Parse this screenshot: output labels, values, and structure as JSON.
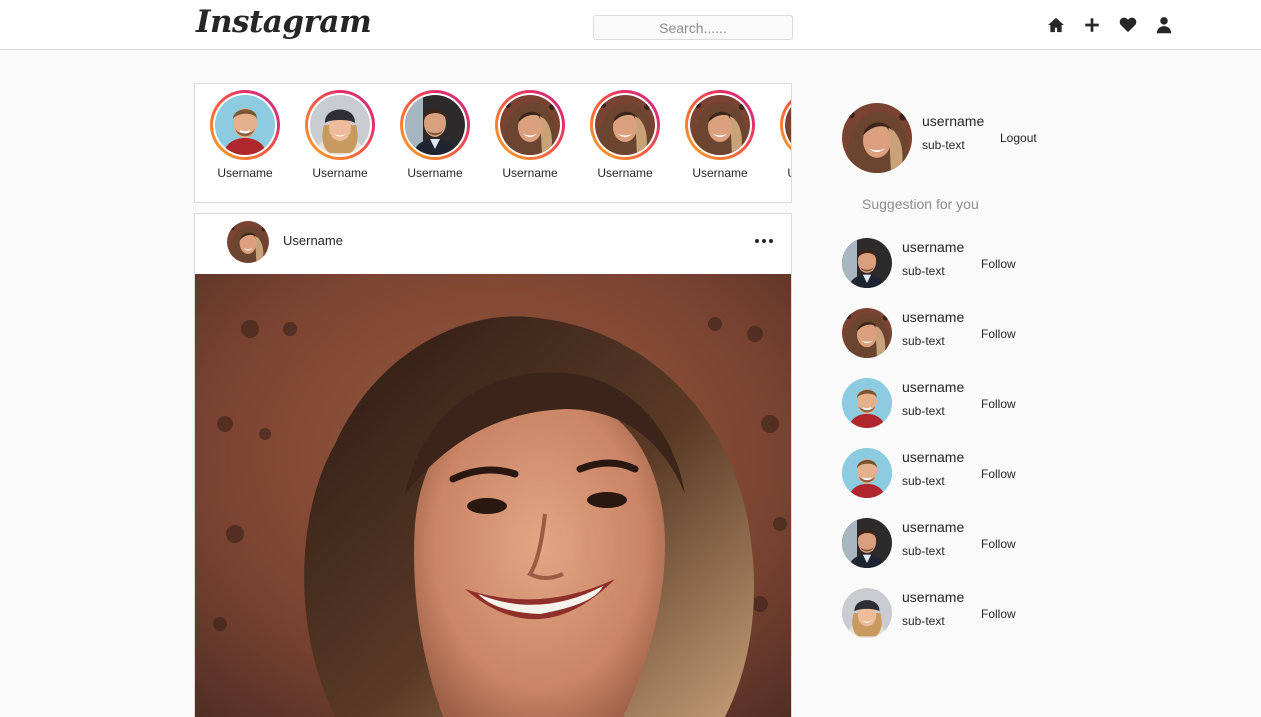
{
  "navbar": {
    "logo": "Instagram",
    "search_placeholder": "Search......",
    "icons": [
      "home-icon",
      "plus-icon",
      "heart-icon",
      "user-icon"
    ]
  },
  "stories": [
    {
      "username": "Username",
      "avatar": "man-light"
    },
    {
      "username": "Username",
      "avatar": "woman-beanie"
    },
    {
      "username": "Username",
      "avatar": "man-dark"
    },
    {
      "username": "Username",
      "avatar": "woman-curly"
    },
    {
      "username": "Username",
      "avatar": "woman-curly"
    },
    {
      "username": "Username",
      "avatar": "woman-curly"
    },
    {
      "username": "Username",
      "avatar": "woman-curly"
    }
  ],
  "post": {
    "username": "Username",
    "avatar": "woman-curly",
    "more_icon": "more-dots-icon"
  },
  "profile": {
    "username": "username",
    "sub_text": "sub-text",
    "logout_label": "Logout"
  },
  "suggestions_title": "Suggestion for you",
  "suggestions": [
    {
      "username": "username",
      "sub_text": "sub-text",
      "action": "Follow",
      "avatar": "man-dark"
    },
    {
      "username": "username",
      "sub_text": "sub-text",
      "action": "Follow",
      "avatar": "woman-curly"
    },
    {
      "username": "username",
      "sub_text": "sub-text",
      "action": "Follow",
      "avatar": "man-light"
    },
    {
      "username": "username",
      "sub_text": "sub-text",
      "action": "Follow",
      "avatar": "man-light"
    },
    {
      "username": "username",
      "sub_text": "sub-text",
      "action": "Follow",
      "avatar": "man-dark"
    },
    {
      "username": "username",
      "sub_text": "sub-text",
      "action": "Follow",
      "avatar": "woman-beanie"
    }
  ],
  "colors": {
    "ring_start": "#f9a825",
    "ring_end": "#c13584",
    "border": "#dbdbdb",
    "background": "#fafafa"
  }
}
